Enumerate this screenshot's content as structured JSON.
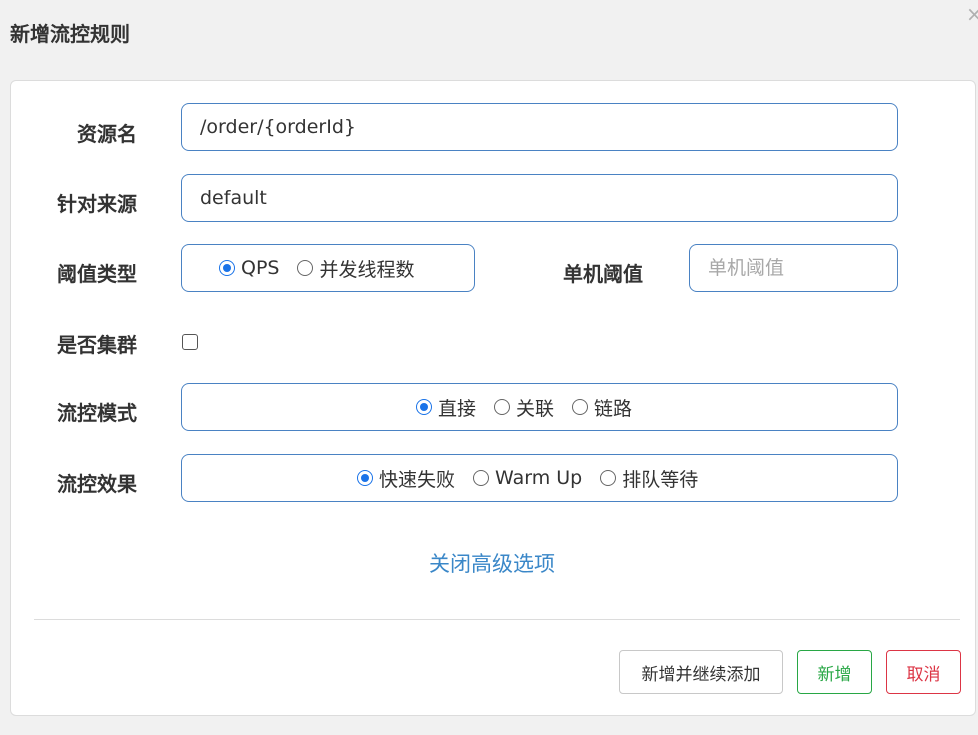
{
  "dialog": {
    "title": "新增流控规则",
    "close_icon": "×"
  },
  "form": {
    "resource": {
      "label": "资源名",
      "value": "/order/{orderId}"
    },
    "limit_app": {
      "label": "针对来源",
      "value": "default"
    },
    "grade": {
      "label": "阈值类型",
      "options": [
        {
          "label": "QPS",
          "checked": true
        },
        {
          "label": "并发线程数",
          "checked": false
        }
      ]
    },
    "count": {
      "label": "单机阈值",
      "placeholder": "单机阈值",
      "value": ""
    },
    "cluster": {
      "label": "是否集群",
      "checked": false
    },
    "strategy": {
      "label": "流控模式",
      "options": [
        {
          "label": "直接",
          "checked": true
        },
        {
          "label": "关联",
          "checked": false
        },
        {
          "label": "链路",
          "checked": false
        }
      ]
    },
    "control_behavior": {
      "label": "流控效果",
      "options": [
        {
          "label": "快速失败",
          "checked": true
        },
        {
          "label": "Warm Up",
          "checked": false
        },
        {
          "label": "排队等待",
          "checked": false
        }
      ]
    },
    "advanced_toggle": "关闭高级选项"
  },
  "footer": {
    "add_continue": "新增并继续添加",
    "add": "新增",
    "cancel": "取消"
  },
  "colors": {
    "accent": "#1a73e8",
    "input_border": "#4a82c3",
    "link": "#3a87c8",
    "success": "#28a745",
    "danger": "#dc3545"
  }
}
